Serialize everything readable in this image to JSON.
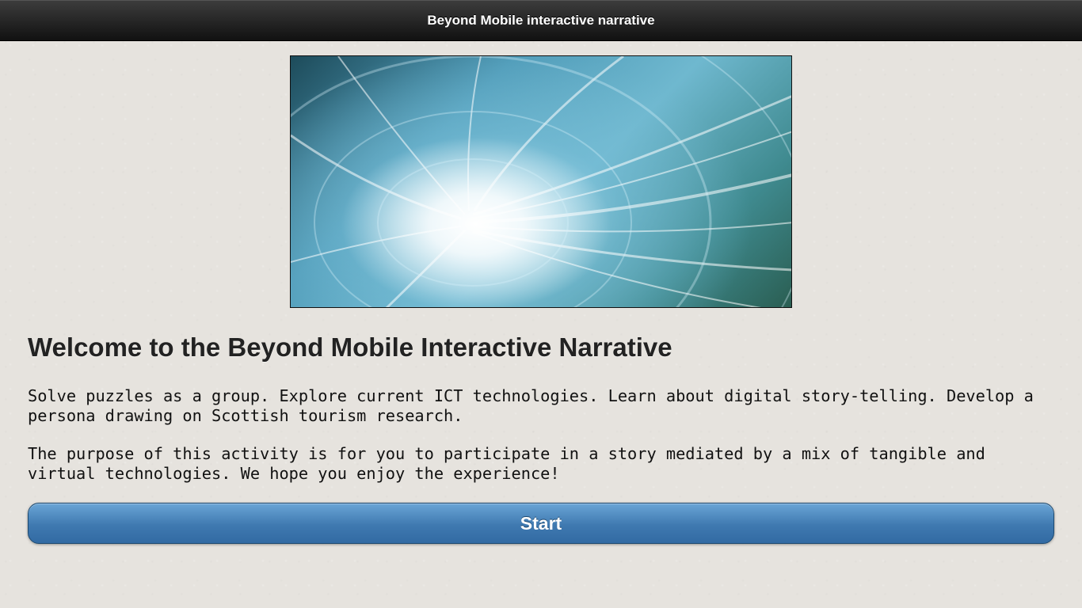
{
  "header": {
    "title": "Beyond Mobile interactive narrative"
  },
  "hero": {
    "image_name": "light-tunnel-image",
    "colors": [
      "#1d4b5a",
      "#4f9bb8",
      "#6fb8cf",
      "#3f8a8f",
      "#ffffff"
    ]
  },
  "main": {
    "heading": "Welcome to the Beyond Mobile Interactive Narrative",
    "paragraph1": "Solve puzzles as a group. Explore current ICT technologies. Learn about digital story-telling. Develop a persona drawing on Scottish tourism research.",
    "paragraph2": "The purpose of this activity is for you to participate in a story mediated by a mix of tangible and virtual technologies. We hope you enjoy the experience!"
  },
  "start_button": {
    "label": "Start",
    "color": "#3f79b0"
  }
}
